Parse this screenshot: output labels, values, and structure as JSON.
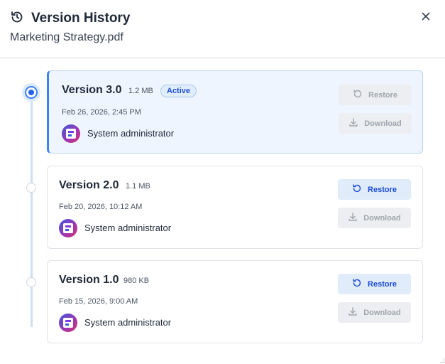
{
  "dialog": {
    "title": "Version History",
    "file_name": "Marketing Strategy.pdf",
    "close_icon": "close-icon",
    "history_icon": "history-icon"
  },
  "versions": [
    {
      "name": "Version 3.0",
      "size": "1.2 MB",
      "badge": "Active",
      "date": "Feb 26, 2026, 2:45 PM",
      "author": "System administrator",
      "restore_label": "Restore",
      "download_label": "Download",
      "active": true,
      "restore_enabled": false,
      "download_enabled": false
    },
    {
      "name": "Version 2.0",
      "size": "1.1 MB",
      "date": "Feb 20, 2026, 10:12 AM",
      "author": "System administrator",
      "restore_label": "Restore",
      "download_label": "Download",
      "active": false,
      "restore_enabled": true,
      "download_enabled": false
    },
    {
      "name": "Version 1.0",
      "size": "980 KB",
      "date": "Feb 15, 2026, 9:00 AM",
      "author": "System administrator",
      "restore_label": "Restore",
      "download_label": "Download",
      "active": false,
      "restore_enabled": true,
      "download_enabled": false
    }
  ],
  "colors": {
    "accent": "#3b82f6",
    "restore_text": "#1d4ed8",
    "disabled_text": "#a0a6ae"
  }
}
